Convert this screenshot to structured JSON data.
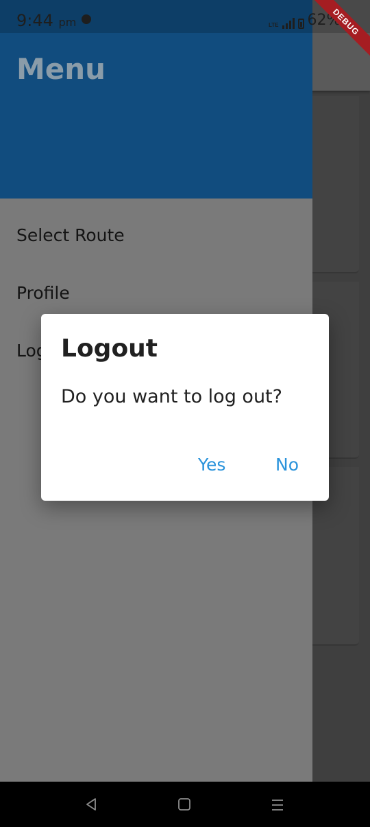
{
  "status_bar": {
    "time": "9:44",
    "ampm": "pm",
    "network": "LTE",
    "battery": "62%"
  },
  "debug_banner": "DEBUG",
  "drawer": {
    "title": "Menu",
    "items": [
      {
        "label": "Select Route"
      },
      {
        "label": "Profile"
      },
      {
        "label": "Logout"
      }
    ]
  },
  "dialog": {
    "title": "Logout",
    "message": "Do you want to log out?",
    "yes_label": "Yes",
    "no_label": "No"
  },
  "colors": {
    "drawer_header": "#114c7e",
    "dialog_button": "#2a93db",
    "debug_banner": "#a51d22"
  },
  "nav_bar": {
    "icons": [
      "back-icon",
      "home-icon",
      "recent-apps-icon"
    ]
  }
}
